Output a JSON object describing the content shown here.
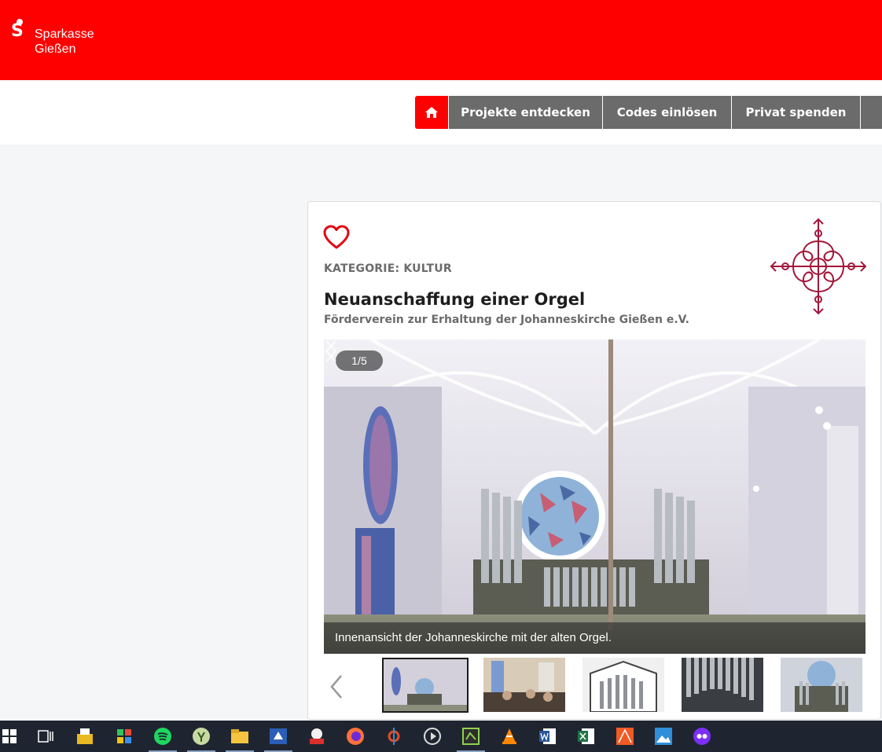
{
  "brand": {
    "line1": "Sparkasse",
    "line2": "Gießen"
  },
  "nav": {
    "home_icon": "home-icon",
    "items": [
      "Projekte entdecken",
      "Codes einlösen",
      "Privat spenden"
    ]
  },
  "project": {
    "category": "KATEGORIE: KULTUR",
    "title": "Neuanschaffung einer Orgel",
    "organization": "Förderverein zur Erhaltung der Johanneskirche Gießen e.V."
  },
  "gallery": {
    "counter": "1/5",
    "caption": "Innenansicht der Johanneskirche mit der alten Orgel.",
    "current_index": 1,
    "total": 5
  },
  "colors": {
    "brand_red": "#ff0000",
    "nav_gray": "#6b6b6b",
    "emblem_red": "#a3163a",
    "taskbar": "#1f2530"
  },
  "taskbar": {
    "icons": [
      "windows-start-icon",
      "task-view-icon",
      "fax-icon",
      "colorful-app-icon",
      "spotify-icon",
      "app-green-icon",
      "file-explorer-icon",
      "scanner-icon",
      "pdf24-icon",
      "firefox-icon",
      "tool-icon",
      "media-player-icon",
      "green-app-icon",
      "vlc-icon",
      "word-icon",
      "excel-icon",
      "orange-app-icon",
      "photos-icon",
      "purple-app-icon"
    ]
  }
}
